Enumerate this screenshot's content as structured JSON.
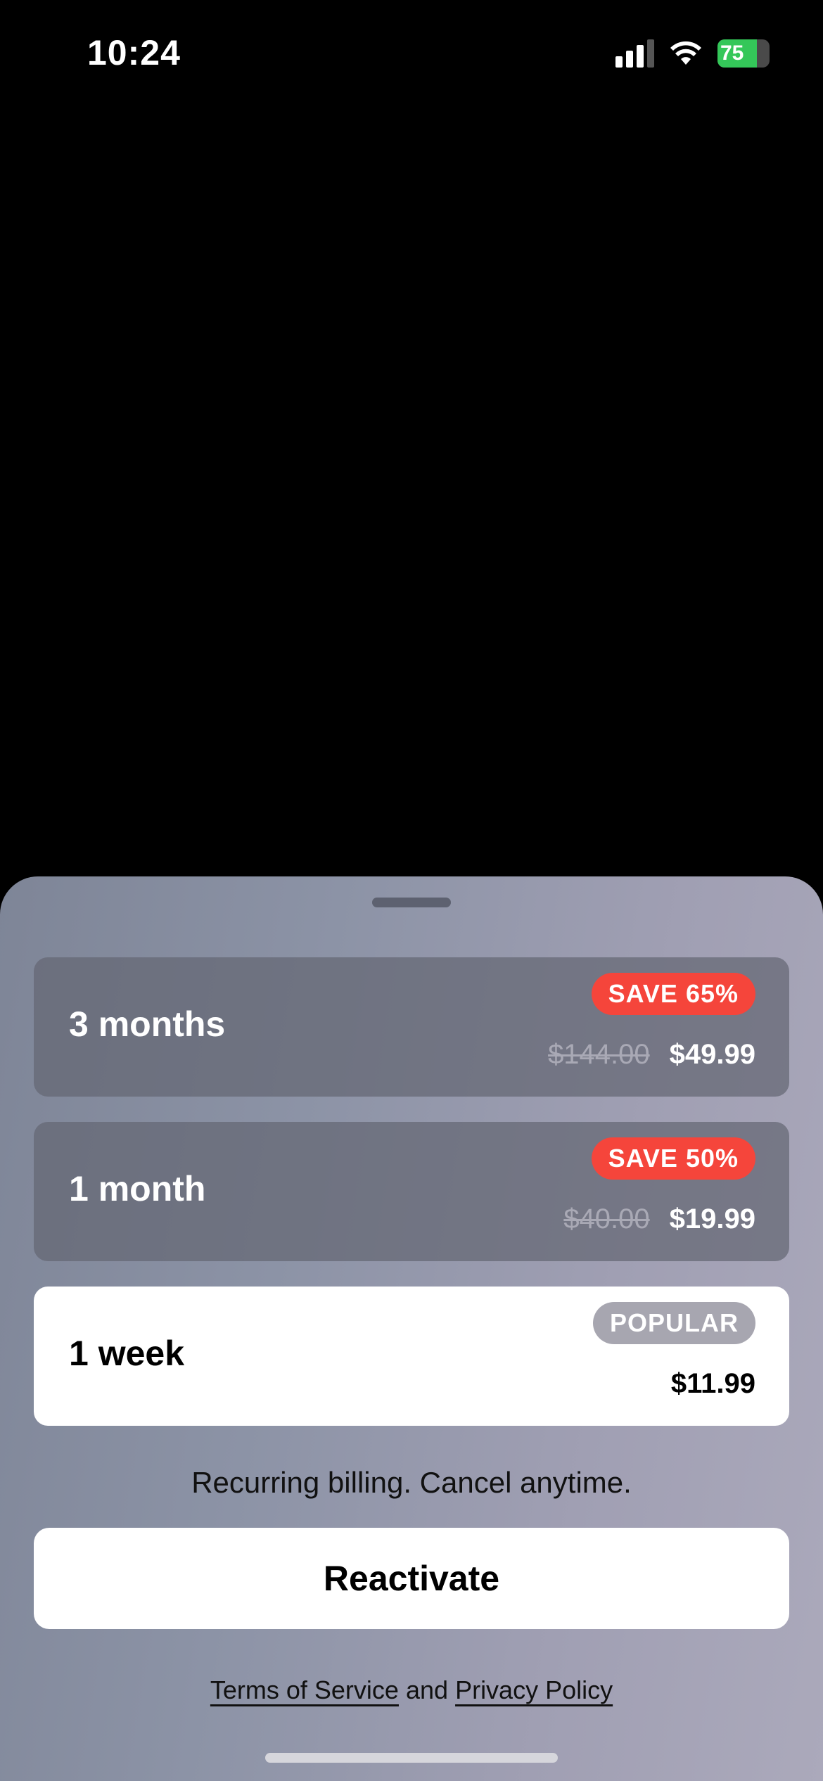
{
  "status_bar": {
    "time": "10:24",
    "battery_level": "75",
    "battery_fraction": 0.75,
    "icons": [
      "cellular-signal-icon",
      "wifi-icon",
      "battery-charging-icon"
    ]
  },
  "plans": [
    {
      "name": "3 months",
      "badge": "SAVE 65%",
      "old_price": "$144.00",
      "price": "$49.99",
      "selected": false
    },
    {
      "name": "1 month",
      "badge": "SAVE 50%",
      "old_price": "$40.00",
      "price": "$19.99",
      "selected": false
    },
    {
      "name": "1 week",
      "badge": "POPULAR",
      "old_price": "",
      "price": "$11.99",
      "selected": true
    }
  ],
  "billing_note": "Recurring billing. Cancel anytime.",
  "cta_label": "Reactivate",
  "legal": {
    "terms": "Terms of Service",
    "and": "and",
    "privacy": "Privacy Policy"
  },
  "colors": {
    "badge_save": "#f5453b",
    "badge_popular": "#a7a6b0",
    "battery": "#34c759"
  }
}
